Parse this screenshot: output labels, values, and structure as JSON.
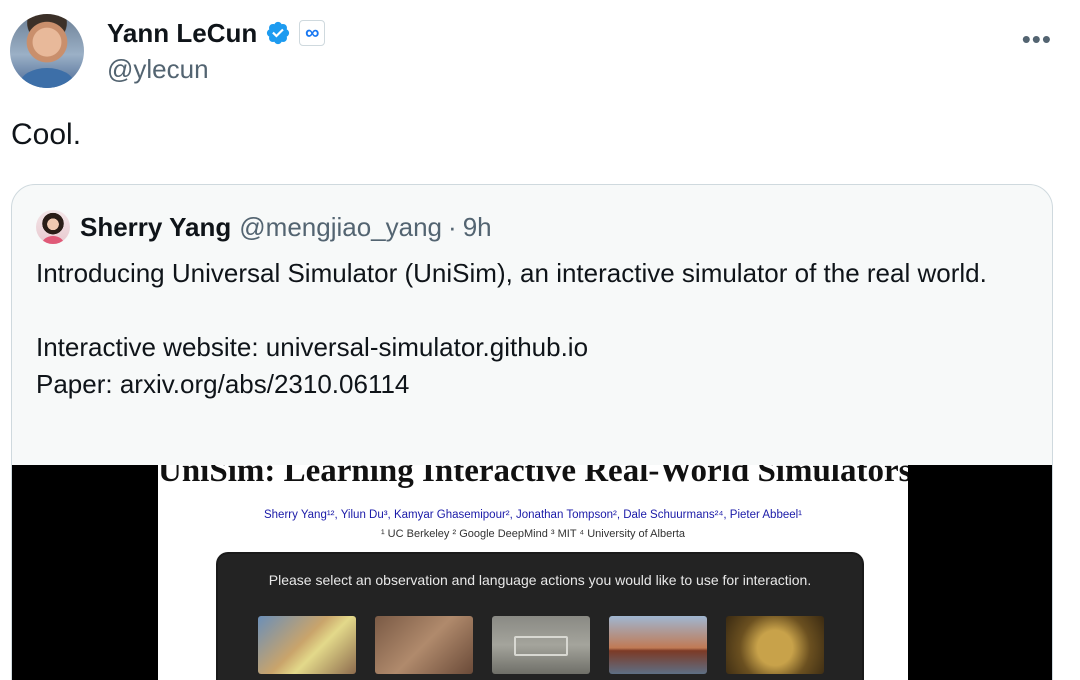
{
  "author": {
    "name": "Yann LeCun",
    "handle": "@ylecun",
    "verified_icon": "verified-badge-icon",
    "affiliation_icon": "meta-infinity-icon",
    "affiliation_glyph": "∞",
    "avatar": "avatar-photo"
  },
  "more_label": "•••",
  "tweet_text": "Cool.",
  "quote": {
    "author_name": "Sherry Yang",
    "author_handle": "@mengjiao_yang",
    "separator": "·",
    "time": "9h",
    "body_line_1": "Introducing Universal Simulator (UniSim), an interactive simulator of the real world.",
    "body_line_2": "Interactive website: universal-simulator.github.io",
    "body_line_3": "Paper: arxiv.org/abs/2310.06114",
    "media": {
      "paper_title": "UniSim: Learning Interactive Real-World Simulators",
      "paper_authors": "Sherry Yang¹², Yilun Du³, Kamyar Ghasemipour², Jonathan Tompson², Dale Schuurmans²⁴, Pieter Abbeel¹",
      "paper_affiliations": "¹ UC Berkeley ² Google DeepMind ³ MIT ⁴ University of Alberta",
      "demo_prompt": "Please select an observation and language actions you would like to use for interaction."
    }
  },
  "colors": {
    "text_primary": "#0f1419",
    "text_secondary": "#536471",
    "verified_blue": "#1d9bf0",
    "border": "#cfd9de"
  }
}
